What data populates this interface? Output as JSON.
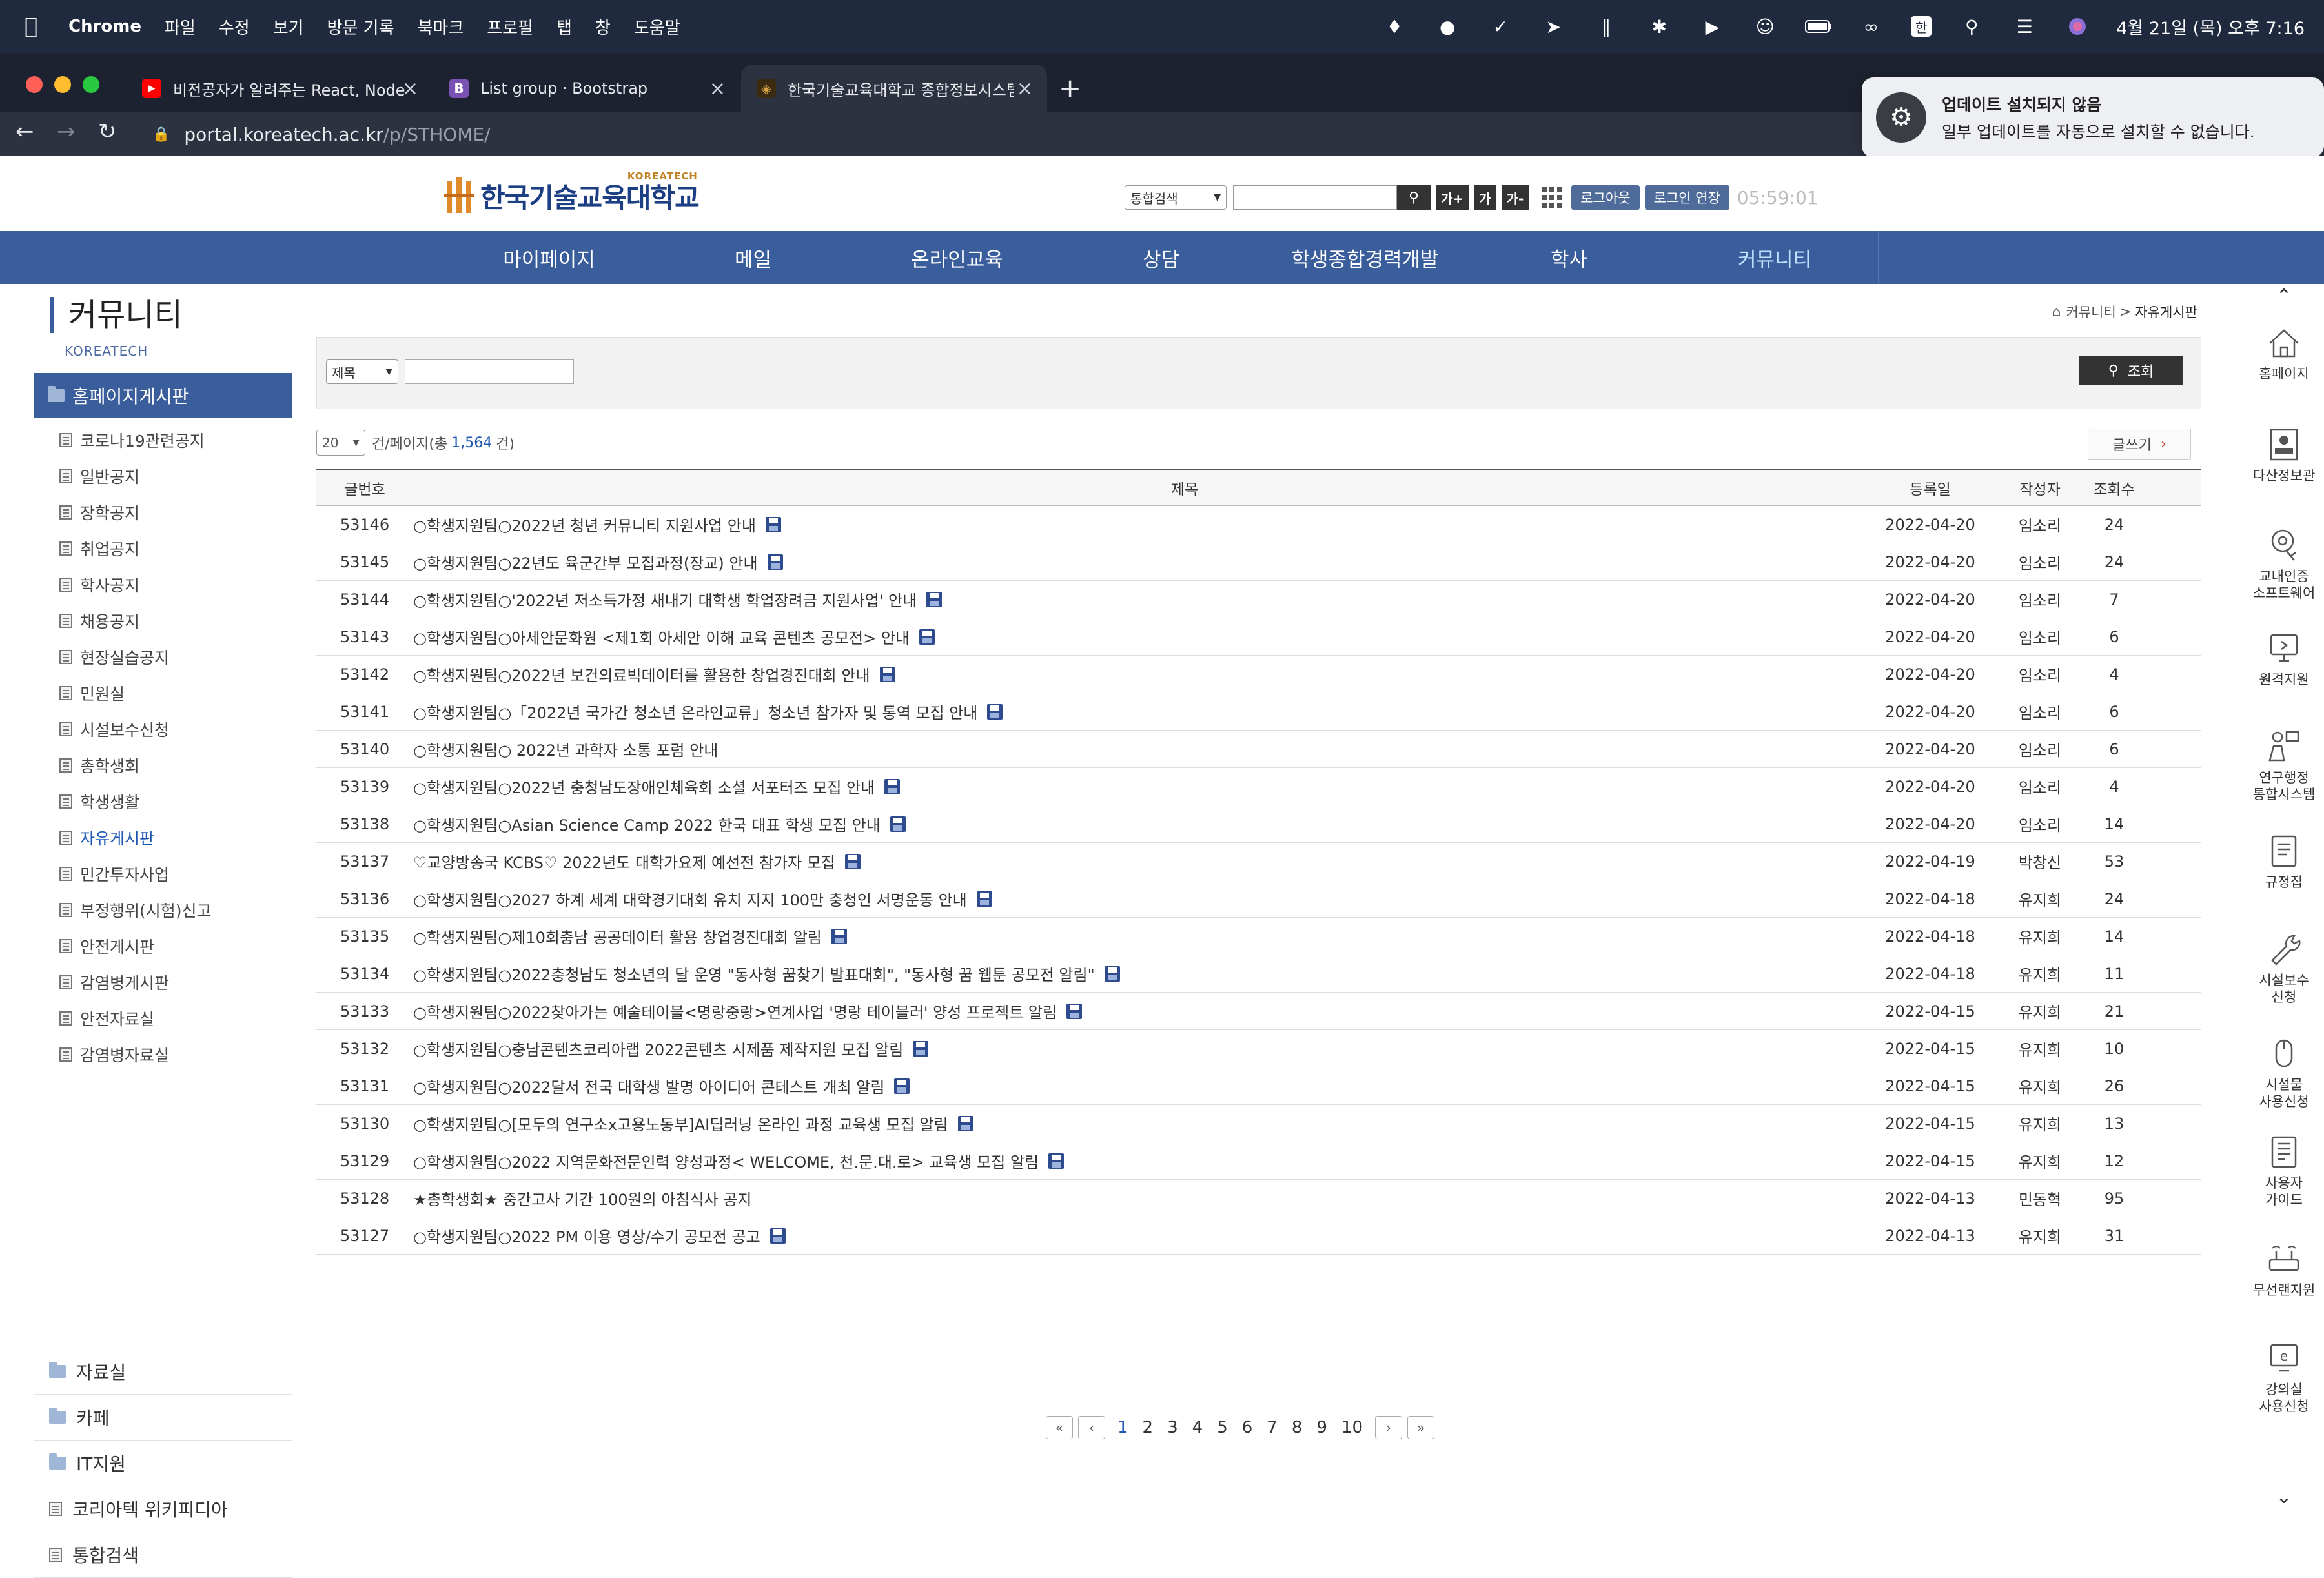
{
  "mac_menubar": {
    "app_name": "Chrome",
    "menus": [
      "파일",
      "수정",
      "보기",
      "방문 기록",
      "북마크",
      "프로필",
      "탭",
      "창",
      "도움말"
    ],
    "clock": "4월 21일 (목) 오후 7:16"
  },
  "browser": {
    "tabs": [
      {
        "title": "비전공자가 알려주는 React, Node"
      },
      {
        "title": "List group · Bootstrap"
      },
      {
        "title": "한국기술교육대학교 종합정보시스템"
      }
    ],
    "url_host": "portal.koreatech.ac.kr",
    "url_path": "/p/STHOME/",
    "update_popup": {
      "title": "업데이트 설치되지 않음",
      "body": "일부 업데이트를 자동으로 설치할 수 없습니다."
    }
  },
  "header": {
    "logo_text": "한국기술교육대학교",
    "logo_en": "KOREATECH",
    "search_scope": "통합검색",
    "font_buttons": [
      "가+",
      "가",
      "가-"
    ],
    "logout_label": "로그아웃",
    "extend_label": "로그인 연장",
    "session_timer": "05:59:01"
  },
  "gnb": [
    "마이페이지",
    "메일",
    "온라인교육",
    "상담",
    "학생종합경력개발",
    "학사",
    "커뮤니티"
  ],
  "sidebar": {
    "title": "커뮤니티",
    "subtitle": "KOREATECH",
    "current_group": "홈페이지게시판",
    "items": [
      "코로나19관련공지",
      "일반공지",
      "장학공지",
      "취업공지",
      "학사공지",
      "채용공지",
      "현장실습공지",
      "민원실",
      "시설보수신청",
      "총학생회",
      "학생생활",
      "자유게시판",
      "민간투자사업",
      "부정행위(시험)신고",
      "안전게시판",
      "감염병게시판",
      "안전자료실",
      "감염병자료실"
    ],
    "groups": [
      "자료실",
      "카페",
      "IT지원",
      "코리아텍 위키피디아",
      "통합검색"
    ]
  },
  "breadcrumb": {
    "parent": "커뮤니티",
    "sep": ">",
    "current": "자유게시판"
  },
  "searchbox": {
    "field": "제목",
    "button": "조회"
  },
  "list_info": {
    "per_page": "20",
    "prefix": "건/페이지(총",
    "total": "1,564",
    "suffix": "건)",
    "write_label": "글쓰기"
  },
  "board": {
    "headers": [
      "글번호",
      "제목",
      "등록일",
      "작성자",
      "조회수"
    ],
    "rows": [
      {
        "no": "53146",
        "title": "○학생지원팀○2022년 청년 커뮤니티 지원사업 안내",
        "date": "2022-04-20",
        "author": "임소리",
        "views": "24",
        "attach": true
      },
      {
        "no": "53145",
        "title": "○학생지원팀○22년도 육군간부 모집과정(장교) 안내",
        "date": "2022-04-20",
        "author": "임소리",
        "views": "24",
        "attach": true
      },
      {
        "no": "53144",
        "title": "○학생지원팀○'2022년 저소득가정 새내기 대학생 학업장려금 지원사업' 안내",
        "date": "2022-04-20",
        "author": "임소리",
        "views": "7",
        "attach": true
      },
      {
        "no": "53143",
        "title": "○학생지원팀○아세안문화원 <제1회 아세안 이해 교육 콘텐츠 공모전> 안내",
        "date": "2022-04-20",
        "author": "임소리",
        "views": "6",
        "attach": true
      },
      {
        "no": "53142",
        "title": "○학생지원팀○2022년 보건의료빅데이터를 활용한 창업경진대회 안내",
        "date": "2022-04-20",
        "author": "임소리",
        "views": "4",
        "attach": true
      },
      {
        "no": "53141",
        "title": "○학생지원팀○「2022년 국가간 청소년 온라인교류」청소년 참가자 및 통역 모집 안내",
        "date": "2022-04-20",
        "author": "임소리",
        "views": "6",
        "attach": true
      },
      {
        "no": "53140",
        "title": "○학생지원팀○ 2022년 과학자 소통 포럼 안내",
        "date": "2022-04-20",
        "author": "임소리",
        "views": "6",
        "attach": false
      },
      {
        "no": "53139",
        "title": "○학생지원팀○2022년 충청남도장애인체육회 소셜 서포터즈 모집 안내",
        "date": "2022-04-20",
        "author": "임소리",
        "views": "4",
        "attach": true
      },
      {
        "no": "53138",
        "title": "○학생지원팀○Asian Science Camp 2022 한국 대표 학생 모집 안내",
        "date": "2022-04-20",
        "author": "임소리",
        "views": "14",
        "attach": true
      },
      {
        "no": "53137",
        "title": "♡교양방송국 KCBS♡ 2022년도 대학가요제 예선전 참가자 모집",
        "date": "2022-04-19",
        "author": "박창신",
        "views": "53",
        "attach": true
      },
      {
        "no": "53136",
        "title": "○학생지원팀○2027 하계 세계 대학경기대회 유치 지지 100만 충청인 서명운동 안내",
        "date": "2022-04-18",
        "author": "유지희",
        "views": "24",
        "attach": true
      },
      {
        "no": "53135",
        "title": "○학생지원팀○제10회충남 공공데이터 활용 창업경진대회 알림",
        "date": "2022-04-18",
        "author": "유지희",
        "views": "14",
        "attach": true
      },
      {
        "no": "53134",
        "title": "○학생지원팀○2022충청남도 청소년의 달 운영 \"동사형 꿈찾기 발표대회\", \"동사형 꿈 웹툰 공모전 알림\"",
        "date": "2022-04-18",
        "author": "유지희",
        "views": "11",
        "attach": true
      },
      {
        "no": "53133",
        "title": "○학생지원팀○2022찾아가는 예술테이블<명랑중랑>연계사업 '명랑 테이블러' 양성 프로젝트 알림",
        "date": "2022-04-15",
        "author": "유지희",
        "views": "21",
        "attach": true
      },
      {
        "no": "53132",
        "title": "○학생지원팀○충남콘텐츠코리아랩 2022콘텐츠 시제품 제작지원 모집 알림",
        "date": "2022-04-15",
        "author": "유지희",
        "views": "10",
        "attach": true
      },
      {
        "no": "53131",
        "title": "○학생지원팀○2022달서 전국 대학생 발명 아이디어 콘테스트 개최 알림",
        "date": "2022-04-15",
        "author": "유지희",
        "views": "26",
        "attach": true
      },
      {
        "no": "53130",
        "title": "○학생지원팀○[모두의 연구소x고용노동부]AI딥러닝 온라인 과정 교육생 모집 알림",
        "date": "2022-04-15",
        "author": "유지희",
        "views": "13",
        "attach": true
      },
      {
        "no": "53129",
        "title": "○학생지원팀○2022 지역문화전문인력 양성과정< WELCOME, 천.문.대.로> 교육생 모집 알림",
        "date": "2022-04-15",
        "author": "유지희",
        "views": "12",
        "attach": true
      },
      {
        "no": "53128",
        "title": "★총학생회★ 중간고사 기간 100원의 아침식사 공지",
        "date": "2022-04-13",
        "author": "민동혁",
        "views": "95",
        "attach": false
      },
      {
        "no": "53127",
        "title": "○학생지원팀○2022 PM 이용 영상/수기 공모전 공고",
        "date": "2022-04-13",
        "author": "유지희",
        "views": "31",
        "attach": true
      }
    ]
  },
  "pagination": {
    "pages": [
      "1",
      "2",
      "3",
      "4",
      "5",
      "6",
      "7",
      "8",
      "9",
      "10"
    ],
    "current": "1"
  },
  "quick_menu": [
    {
      "icon": "home-icon",
      "label1": "홈페이지",
      "label2": ""
    },
    {
      "icon": "id-card-icon",
      "label1": "다산정보관",
      "label2": ""
    },
    {
      "icon": "certificate-icon",
      "label1": "교내인증",
      "label2": "소프트웨어"
    },
    {
      "icon": "remote-support-icon",
      "label1": "원격지원",
      "label2": ""
    },
    {
      "icon": "research-admin-icon",
      "label1": "연구행정",
      "label2": "통합시스템"
    },
    {
      "icon": "regulation-icon",
      "label1": "규정집",
      "label2": ""
    },
    {
      "icon": "wrench-icon",
      "label1": "시설보수",
      "label2": "신청"
    },
    {
      "icon": "facility-icon",
      "label1": "시설물",
      "label2": "사용신청"
    },
    {
      "icon": "guide-icon",
      "label1": "사용자",
      "label2": "가이드"
    },
    {
      "icon": "wifi-router-icon",
      "label1": "무선랜지원",
      "label2": ""
    },
    {
      "icon": "lecture-room-icon",
      "label1": "강의실",
      "label2": "사용신청"
    }
  ]
}
